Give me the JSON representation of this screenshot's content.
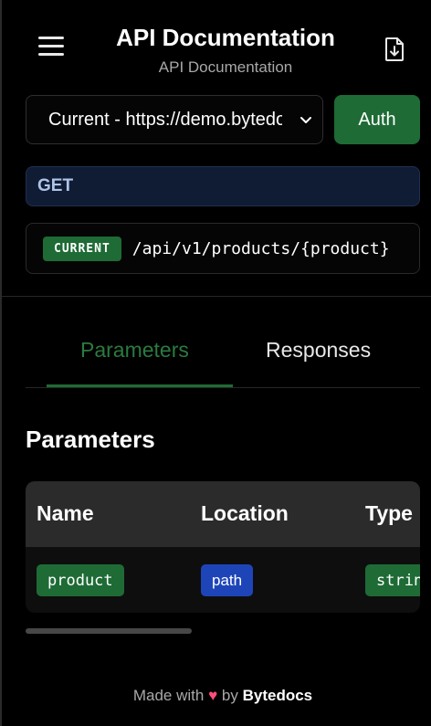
{
  "header": {
    "title": "API Documentation",
    "subtitle": "API Documentation",
    "menu_icon": "hamburger-menu-icon",
    "download_icon": "file-download-icon"
  },
  "server": {
    "selected": "Current - https://demo.bytedocs.com",
    "auth_label": "Auth"
  },
  "endpoint": {
    "method": "GET",
    "environment": "CURRENT",
    "path": "/api/v1/products/{product}"
  },
  "tabs": [
    {
      "label": "Parameters",
      "active": true
    },
    {
      "label": "Responses",
      "active": false
    }
  ],
  "parameters": {
    "title": "Parameters",
    "columns": [
      "Name",
      "Location",
      "Type"
    ],
    "rows": [
      {
        "name": "product",
        "location": "path",
        "type": "string"
      }
    ]
  },
  "footer": {
    "made_with": "Made with",
    "heart": "♥",
    "by": "by",
    "brand": "Bytedocs"
  },
  "colors": {
    "accent_green": "#1e6b35",
    "tab_active": "#2b7a3f",
    "location_blue": "#1e45b8",
    "method_bg": "#101c33",
    "heart": "#ff4f7b"
  }
}
